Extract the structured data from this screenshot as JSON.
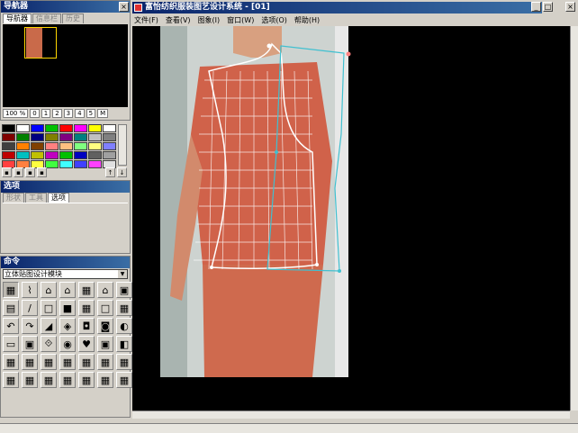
{
  "navigator": {
    "title": "导航器",
    "tabs": [
      "导航器",
      "信息栏",
      "历史"
    ],
    "zoom_options": [
      "100 %",
      "0",
      "1",
      "2",
      "3",
      "4",
      "5",
      "M"
    ]
  },
  "colors": [
    "#000000",
    "#ffffff",
    "#0000ff",
    "#00c000",
    "#ff0000",
    "#ff00ff",
    "#ffff00",
    "#ffffff",
    "#800000",
    "#008000",
    "#000080",
    "#808000",
    "#800080",
    "#008080",
    "#c0c0c0",
    "#808080",
    "#404040",
    "#ff8000",
    "#804000",
    "#ff8080",
    "#ffc080",
    "#80ff80",
    "#ffff80",
    "#8080ff",
    "#c00000",
    "#00c0c0",
    "#c0c000",
    "#c000c0",
    "#00c000",
    "#0000c0",
    "#606060",
    "#a0a0a0",
    "#ff4040",
    "#ff8040",
    "#ffff40",
    "#40ff40",
    "#40ffff",
    "#4040ff",
    "#ff40ff",
    "#e0e0e0"
  ],
  "options_panel": {
    "title": "选项",
    "tabs": [
      "形状",
      "工具",
      "选项"
    ]
  },
  "command_panel": {
    "title": "命令",
    "module": "立体贴图设计模块"
  },
  "main_window": {
    "title": "富怡纺织服装图艺设计系统 - [01]",
    "menu": [
      "文件(F)",
      "查看(V)",
      "图象(I)",
      "窗口(W)",
      "选项(O)",
      "帮助(H)"
    ]
  }
}
